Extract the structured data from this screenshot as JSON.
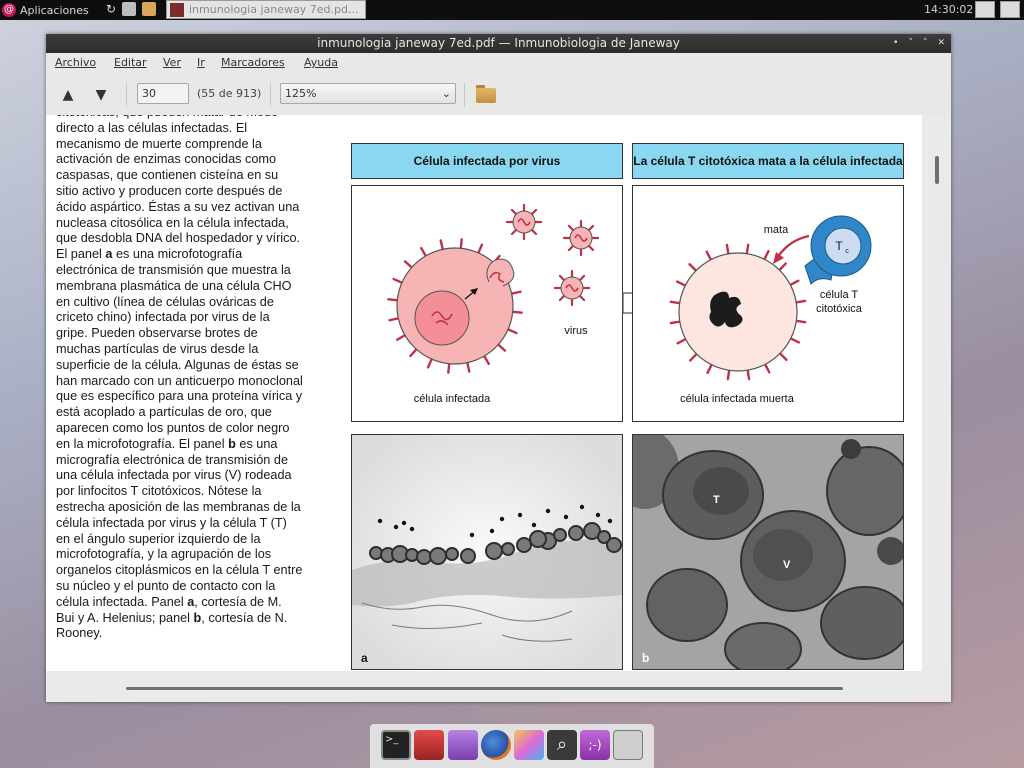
{
  "top_panel": {
    "apps_label": "Aplicaciones",
    "task_title": "inmunologia janeway 7ed.pd...",
    "clock": "14:30:02"
  },
  "window": {
    "title": "inmunologia janeway 7ed.pdf — Inmunobiologia de Janeway",
    "controls": [
      "•",
      "˅",
      "˄",
      "✕"
    ]
  },
  "menu": [
    "Archivo",
    "Editar",
    "Ver",
    "Ir",
    "Marcadores",
    "Ayuda"
  ],
  "toolbar": {
    "page_value": "30",
    "page_count": "(55 de 913)",
    "zoom": "125%",
    "prev_icon": "arrow-up-icon",
    "next_icon": "arrow-down-icon",
    "open_icon": "folder-icon"
  },
  "caption_lines": [
    "citotóxicas, que pueden matar de modo",
    "directo a las células infectadas. El",
    "mecanismo de muerte comprende la",
    "activación de enzimas conocidas como",
    "caspasas, que contienen cisteína en su",
    "sitio activo y producen corte después de",
    "ácido aspártico. Éstas a su vez activan una",
    "nucleasa citosólica en la célula infectada,",
    "que desdobla DNA del hospedador y vírico.",
    "El panel ##a## es una microfotografía",
    "electrónica de transmisión que muestra la",
    "membrana plasmática de una célula CHO",
    "en cultivo (línea de células ováricas de",
    "criceto chino) infectada por virus de la",
    "gripe. Pueden observarse brotes de",
    "muchas partículas de virus desde la",
    "superficie de la célula. Algunas de éstas se",
    "han marcado con un anticuerpo monoclonal",
    "que es específico para una proteína vírica y",
    "está acoplado a partículas de oro, que",
    "aparecen como los puntos de color negro",
    "en la microfotografía. El panel ##b## es una",
    "micrografía electrónica de transmisión de",
    "una célula infectada por virus (V) rodeada",
    "por linfocitos T citotóxicos. Nótese la",
    "estrecha aposición de las membranas de la",
    "célula infectada por virus y la célula T (T)",
    "en el ángulo superior izquierdo de la",
    "microfotografía, y la agrupación de los",
    "organelos citoplásmicos en la célula T entre",
    "su núcleo y el punto de contacto con la",
    "célula infectada. Panel ##a##, cortesía de M.",
    "Bui y A. Helenius; panel ##b##, cortesía de N.",
    "Rooney."
  ],
  "figure": {
    "left_header": "Célula infectada por virus",
    "right_header": "La célula T citotóxica mata a la célula infectada",
    "left_labels": {
      "virus": "virus",
      "infected": "célula infectada"
    },
    "right_labels": {
      "kills": "mata",
      "tc": "T",
      "tc_sub": "c",
      "tcell_line1": "célula T",
      "tcell_line2": "citotóxica",
      "dead": "célula infectada muerta"
    },
    "photo_a_label": "a",
    "photo_b_label": "b",
    "photo_b_t": "T",
    "photo_b_v": "V"
  },
  "dock_items": [
    "terminal-icon",
    "app-store-icon",
    "ebook-reader-icon",
    "firefox-icon",
    "paint-icon",
    "search-icon",
    "chat-icon",
    "mixer-icon"
  ]
}
